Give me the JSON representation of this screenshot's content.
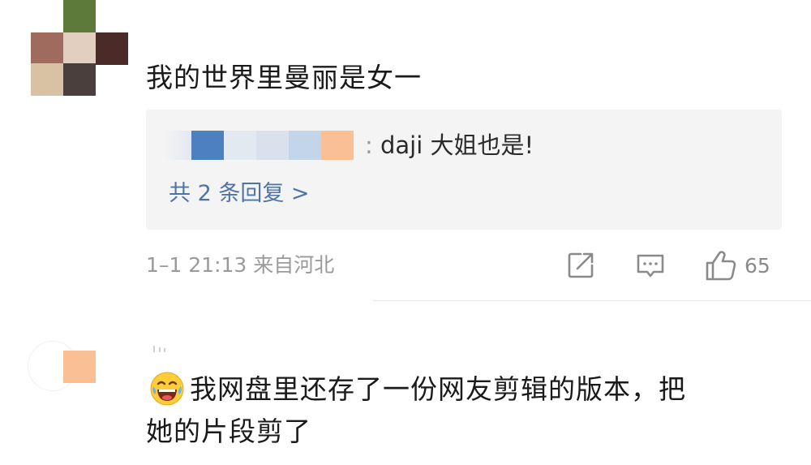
{
  "comment1": {
    "text": "我的世界里曼丽是女一",
    "reply": {
      "separator": ":",
      "text": "daji 大姐也是!",
      "count_label": "共 2 条回复 >"
    },
    "meta": "1–1 21:13  来自河北",
    "likes": "65"
  },
  "comment2": {
    "line1": "我网盘里还存了一份网友剪辑的版本，把",
    "line2": "她的片段剪了"
  },
  "colors": {
    "reply_link": "#4e74a6",
    "meta_gray": "#9a9a9a",
    "reply_bg": "#f4f4f4"
  },
  "icons": [
    "share-icon",
    "comment-icon",
    "like-icon",
    "laughing-emoji-icon"
  ]
}
